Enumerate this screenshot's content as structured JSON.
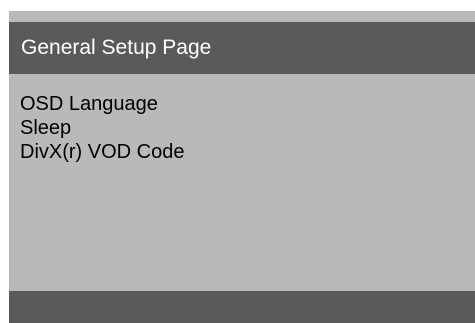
{
  "header": {
    "title": "General Setup Page"
  },
  "menu": {
    "items": [
      {
        "label": "OSD Language"
      },
      {
        "label": "Sleep"
      },
      {
        "label": "DivX(r) VOD Code"
      }
    ]
  },
  "colors": {
    "header_bg": "#5a5a5a",
    "panel_bg": "#b9b9b9",
    "footer_bg": "#5a5a5a",
    "header_text": "#ffffff",
    "item_text": "#000000"
  }
}
